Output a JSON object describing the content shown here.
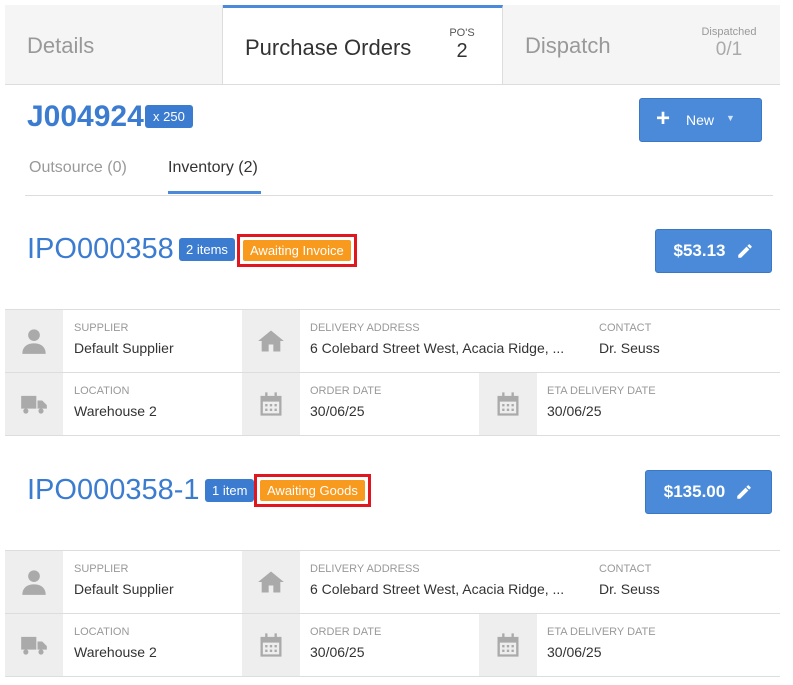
{
  "tabs": {
    "details": {
      "label": "Details"
    },
    "purchase_orders": {
      "label": "Purchase Orders",
      "count_label": "PO'S",
      "count": "2"
    },
    "dispatch": {
      "label": "Dispatch",
      "count_label": "Dispatched",
      "count": "0/1"
    }
  },
  "job": {
    "number": "J004924",
    "quantity_badge": "x 250"
  },
  "new_button": {
    "label": "New",
    "icon": "plus-icon"
  },
  "sub_tabs": {
    "outsource": "Outsource (0)",
    "inventory": "Inventory (2)",
    "active": "inventory"
  },
  "purchase_orders": [
    {
      "number": "IPO000358",
      "items_badge": "2 items",
      "status": "Awaiting Invoice",
      "total": "$53.13",
      "supplier_label": "SUPPLIER",
      "supplier": "Default Supplier",
      "delivery_label": "DELIVERY ADDRESS",
      "delivery_address": "6 Colebard Street West, Acacia Ridge, ...",
      "contact_label": "CONTACT",
      "contact": "Dr. Seuss",
      "location_label": "LOCATION",
      "location": "Warehouse 2",
      "order_date_label": "ORDER DATE",
      "order_date": "30/06/25",
      "eta_label": "ETA DELIVERY DATE",
      "eta_date": "30/06/25"
    },
    {
      "number": "IPO000358-1",
      "items_badge": "1 item",
      "status": "Awaiting Goods",
      "total": "$135.00",
      "supplier_label": "SUPPLIER",
      "supplier": "Default Supplier",
      "delivery_label": "DELIVERY ADDRESS",
      "delivery_address": "6 Colebard Street West, Acacia Ridge, ...",
      "contact_label": "CONTACT",
      "contact": "Dr. Seuss",
      "location_label": "LOCATION",
      "location": "Warehouse 2",
      "order_date_label": "ORDER DATE",
      "order_date": "30/06/25",
      "eta_label": "ETA DELIVERY DATE",
      "eta_date": "30/06/25"
    }
  ],
  "colors": {
    "primary": "#3b7cd0",
    "button": "#4a8ad8",
    "status_orange": "#f79a1e",
    "highlight_red": "#e1171f"
  }
}
